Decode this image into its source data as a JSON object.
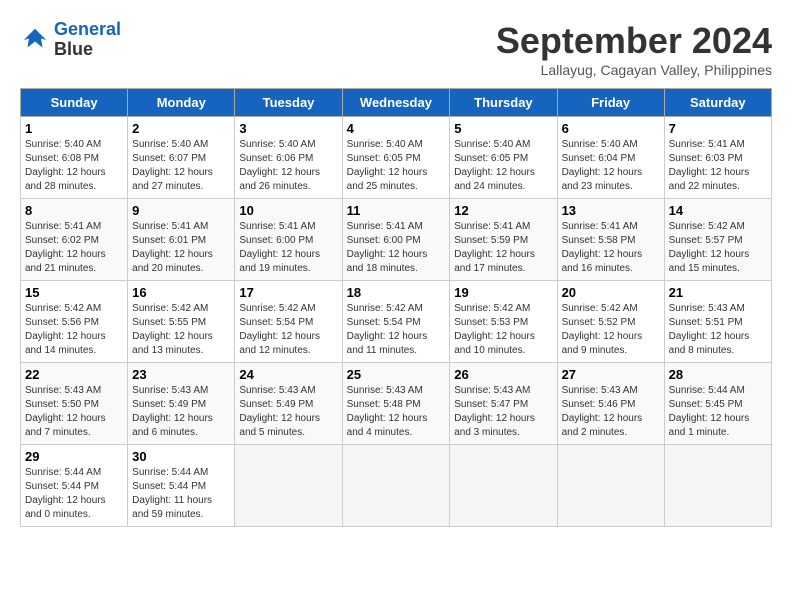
{
  "header": {
    "logo_line1": "General",
    "logo_line2": "Blue",
    "month_title": "September 2024",
    "location": "Lallayug, Cagayan Valley, Philippines"
  },
  "weekdays": [
    "Sunday",
    "Monday",
    "Tuesday",
    "Wednesday",
    "Thursday",
    "Friday",
    "Saturday"
  ],
  "weeks": [
    [
      {
        "day": "1",
        "info": "Sunrise: 5:40 AM\nSunset: 6:08 PM\nDaylight: 12 hours\nand 28 minutes."
      },
      {
        "day": "2",
        "info": "Sunrise: 5:40 AM\nSunset: 6:07 PM\nDaylight: 12 hours\nand 27 minutes."
      },
      {
        "day": "3",
        "info": "Sunrise: 5:40 AM\nSunset: 6:06 PM\nDaylight: 12 hours\nand 26 minutes."
      },
      {
        "day": "4",
        "info": "Sunrise: 5:40 AM\nSunset: 6:05 PM\nDaylight: 12 hours\nand 25 minutes."
      },
      {
        "day": "5",
        "info": "Sunrise: 5:40 AM\nSunset: 6:05 PM\nDaylight: 12 hours\nand 24 minutes."
      },
      {
        "day": "6",
        "info": "Sunrise: 5:40 AM\nSunset: 6:04 PM\nDaylight: 12 hours\nand 23 minutes."
      },
      {
        "day": "7",
        "info": "Sunrise: 5:41 AM\nSunset: 6:03 PM\nDaylight: 12 hours\nand 22 minutes."
      }
    ],
    [
      {
        "day": "8",
        "info": "Sunrise: 5:41 AM\nSunset: 6:02 PM\nDaylight: 12 hours\nand 21 minutes."
      },
      {
        "day": "9",
        "info": "Sunrise: 5:41 AM\nSunset: 6:01 PM\nDaylight: 12 hours\nand 20 minutes."
      },
      {
        "day": "10",
        "info": "Sunrise: 5:41 AM\nSunset: 6:00 PM\nDaylight: 12 hours\nand 19 minutes."
      },
      {
        "day": "11",
        "info": "Sunrise: 5:41 AM\nSunset: 6:00 PM\nDaylight: 12 hours\nand 18 minutes."
      },
      {
        "day": "12",
        "info": "Sunrise: 5:41 AM\nSunset: 5:59 PM\nDaylight: 12 hours\nand 17 minutes."
      },
      {
        "day": "13",
        "info": "Sunrise: 5:41 AM\nSunset: 5:58 PM\nDaylight: 12 hours\nand 16 minutes."
      },
      {
        "day": "14",
        "info": "Sunrise: 5:42 AM\nSunset: 5:57 PM\nDaylight: 12 hours\nand 15 minutes."
      }
    ],
    [
      {
        "day": "15",
        "info": "Sunrise: 5:42 AM\nSunset: 5:56 PM\nDaylight: 12 hours\nand 14 minutes."
      },
      {
        "day": "16",
        "info": "Sunrise: 5:42 AM\nSunset: 5:55 PM\nDaylight: 12 hours\nand 13 minutes."
      },
      {
        "day": "17",
        "info": "Sunrise: 5:42 AM\nSunset: 5:54 PM\nDaylight: 12 hours\nand 12 minutes."
      },
      {
        "day": "18",
        "info": "Sunrise: 5:42 AM\nSunset: 5:54 PM\nDaylight: 12 hours\nand 11 minutes."
      },
      {
        "day": "19",
        "info": "Sunrise: 5:42 AM\nSunset: 5:53 PM\nDaylight: 12 hours\nand 10 minutes."
      },
      {
        "day": "20",
        "info": "Sunrise: 5:42 AM\nSunset: 5:52 PM\nDaylight: 12 hours\nand 9 minutes."
      },
      {
        "day": "21",
        "info": "Sunrise: 5:43 AM\nSunset: 5:51 PM\nDaylight: 12 hours\nand 8 minutes."
      }
    ],
    [
      {
        "day": "22",
        "info": "Sunrise: 5:43 AM\nSunset: 5:50 PM\nDaylight: 12 hours\nand 7 minutes."
      },
      {
        "day": "23",
        "info": "Sunrise: 5:43 AM\nSunset: 5:49 PM\nDaylight: 12 hours\nand 6 minutes."
      },
      {
        "day": "24",
        "info": "Sunrise: 5:43 AM\nSunset: 5:49 PM\nDaylight: 12 hours\nand 5 minutes."
      },
      {
        "day": "25",
        "info": "Sunrise: 5:43 AM\nSunset: 5:48 PM\nDaylight: 12 hours\nand 4 minutes."
      },
      {
        "day": "26",
        "info": "Sunrise: 5:43 AM\nSunset: 5:47 PM\nDaylight: 12 hours\nand 3 minutes."
      },
      {
        "day": "27",
        "info": "Sunrise: 5:43 AM\nSunset: 5:46 PM\nDaylight: 12 hours\nand 2 minutes."
      },
      {
        "day": "28",
        "info": "Sunrise: 5:44 AM\nSunset: 5:45 PM\nDaylight: 12 hours\nand 1 minute."
      }
    ],
    [
      {
        "day": "29",
        "info": "Sunrise: 5:44 AM\nSunset: 5:44 PM\nDaylight: 12 hours\nand 0 minutes."
      },
      {
        "day": "30",
        "info": "Sunrise: 5:44 AM\nSunset: 5:44 PM\nDaylight: 11 hours\nand 59 minutes."
      },
      {
        "day": "",
        "info": ""
      },
      {
        "day": "",
        "info": ""
      },
      {
        "day": "",
        "info": ""
      },
      {
        "day": "",
        "info": ""
      },
      {
        "day": "",
        "info": ""
      }
    ]
  ]
}
